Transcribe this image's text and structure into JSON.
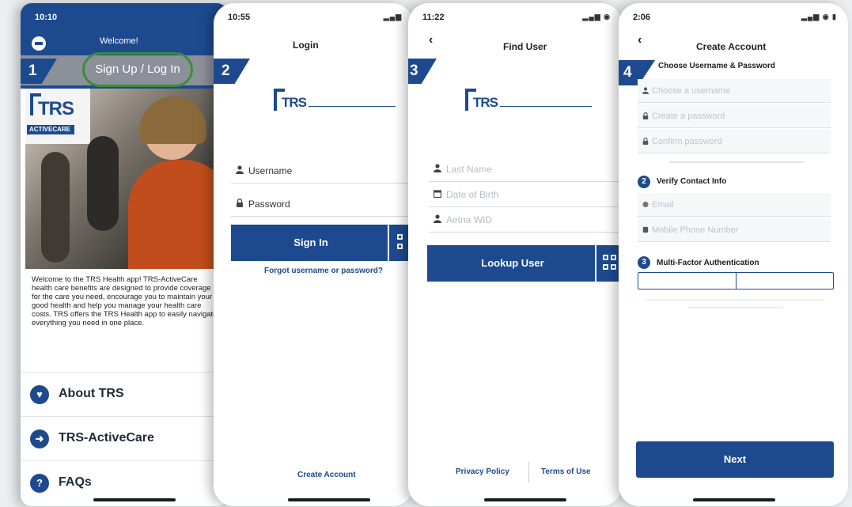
{
  "screen1": {
    "status_time": "10:10",
    "header": "Welcome!",
    "signup_button": "Sign Up / Log In",
    "step": "1",
    "logo_text": "TRS",
    "logo_sub": "ACTIVECARE",
    "welcome_text": "Welcome to the TRS Health app! TRS-ActiveCare health care benefits are designed to provide coverage for the care you need, encourage you to maintain your good health and help you manage your health care costs. TRS offers the TRS Health app to easily navigate everything you need in one place.",
    "menu": [
      {
        "label": "About TRS",
        "icon": "heart-icon"
      },
      {
        "label": "TRS-ActiveCare",
        "icon": "arrow-right-icon"
      },
      {
        "label": "FAQs",
        "icon": "question-icon"
      }
    ]
  },
  "screen2": {
    "status_time": "10:55",
    "title": "Login",
    "step": "2",
    "logo_text": "TRS",
    "username_label": "Username",
    "password_label": "Password",
    "signin_button": "Sign In",
    "forgot_link": "Forgot username or password?",
    "create_account_link": "Create Account"
  },
  "screen3": {
    "status_time": "11:22",
    "title": "Find User",
    "back": "‹",
    "step": "3",
    "logo_text": "TRS",
    "fields": [
      "Last Name",
      "Date of Birth",
      "Aetna WID"
    ],
    "lookup_button": "Lookup User",
    "privacy_link": "Privacy Policy",
    "terms_link": "Terms of Use"
  },
  "screen4": {
    "status_time": "2:06",
    "title": "Create Account",
    "back": "‹",
    "step": "4",
    "section1": "Choose Username & Password",
    "username_placeholder": "Choose a username",
    "password_placeholder": "Create a password",
    "confirm_placeholder": "Confirm password",
    "section2_num": "2",
    "section2": "Verify Contact Info",
    "email_placeholder": "Email",
    "phone_placeholder": "Mobile Phone Number",
    "section3_num": "3",
    "section3": "Multi-Factor Authentication",
    "next_button": "Next"
  },
  "colors": {
    "brand": "#1d4a8f",
    "highlight": "#3c8c3c",
    "bg": "#eceef1"
  }
}
